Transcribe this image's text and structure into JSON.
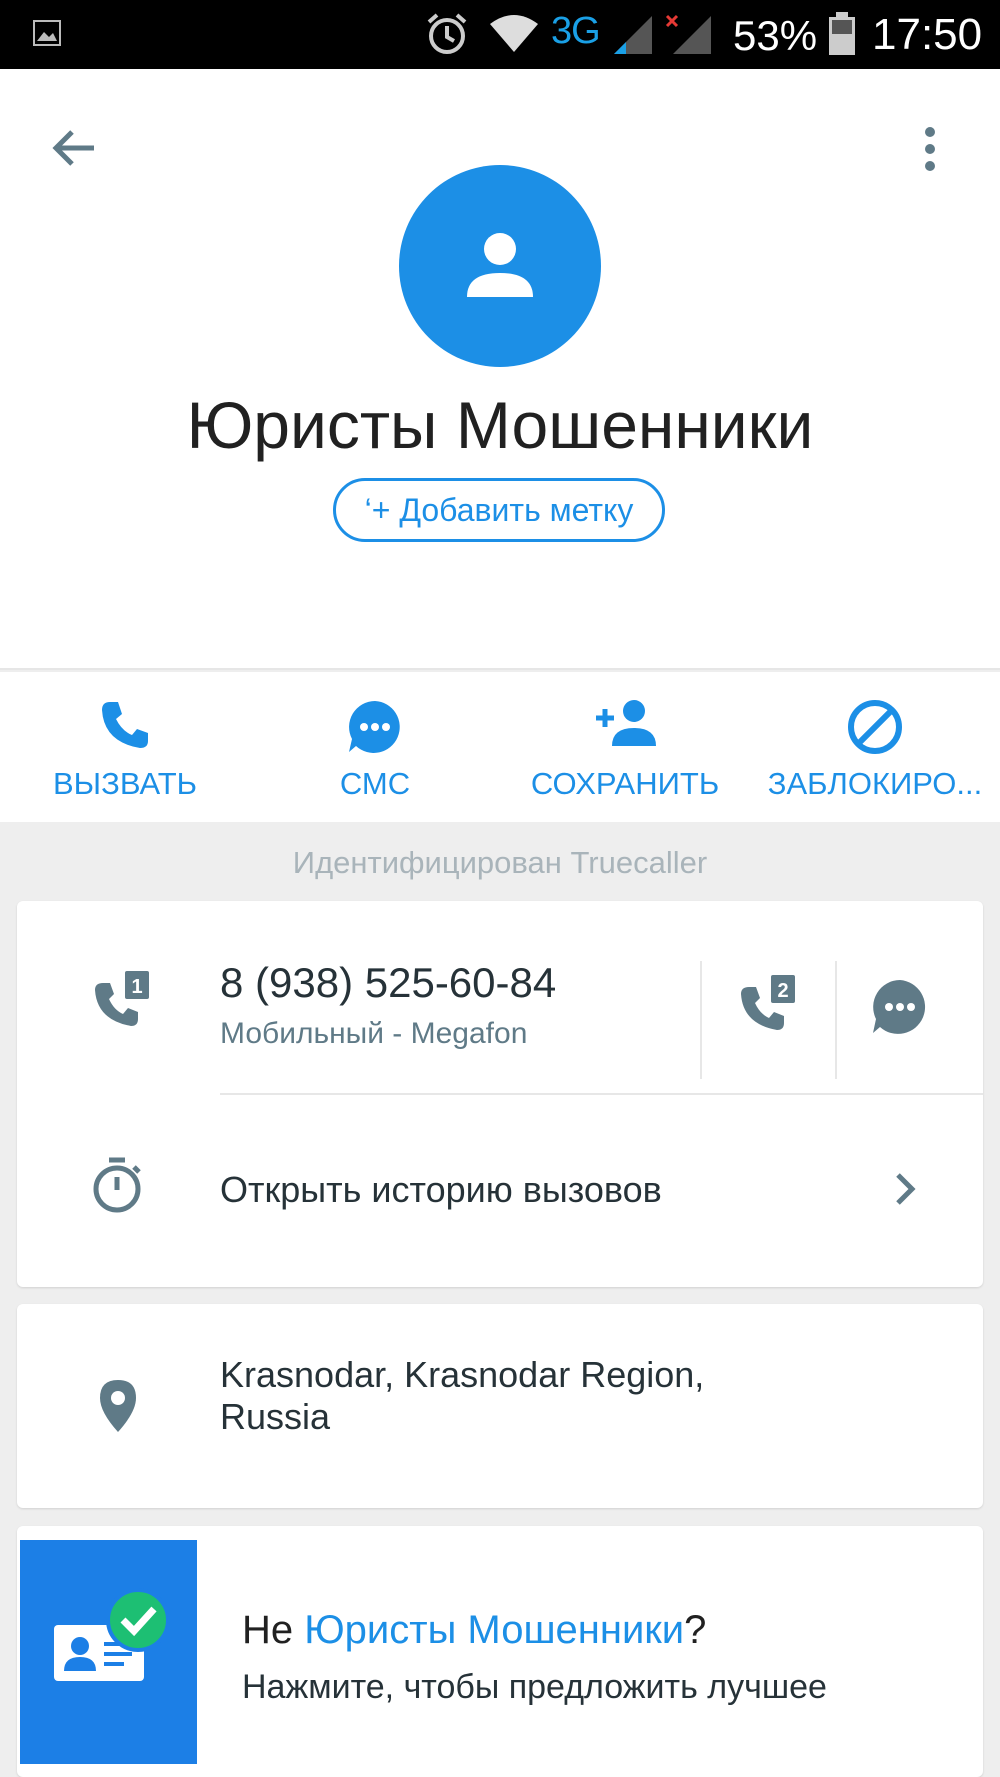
{
  "status_bar": {
    "network": "3G",
    "battery_percent": "53%",
    "time": "17:50"
  },
  "header": {
    "contact_name": "Юристы Мошенники",
    "add_tag_label": "‘+ Добавить метку"
  },
  "actions": [
    {
      "label": "ВЫЗВАТЬ",
      "icon": "phone-icon"
    },
    {
      "label": "СМС",
      "icon": "chat-bubble-icon"
    },
    {
      "label": "СОХРАНИТЬ",
      "icon": "add-person-icon"
    },
    {
      "label": "ЗАБЛОКИРО...",
      "icon": "block-icon"
    }
  ],
  "identified_label": "Идентифицирован Truecaller",
  "phone_card": {
    "number": "8 (938) 525-60-84",
    "type": "Мобильный - Megafon",
    "sim1_badge": "1",
    "sim2_badge": "2",
    "history_label": "Открыть историю вызовов"
  },
  "location_card": {
    "address_line1": "Krasnodar, Krasnodar Region,",
    "address_line2": "Russia"
  },
  "suggestion_card": {
    "prefix": "Не ",
    "name": "Юристы Мошенники",
    "suffix": "?",
    "subtitle": "Нажмите, чтобы предложить лучшее"
  },
  "colors": {
    "accent": "#1c8fe6",
    "icon_gray": "#5f7a87",
    "success": "#1dbf73"
  }
}
